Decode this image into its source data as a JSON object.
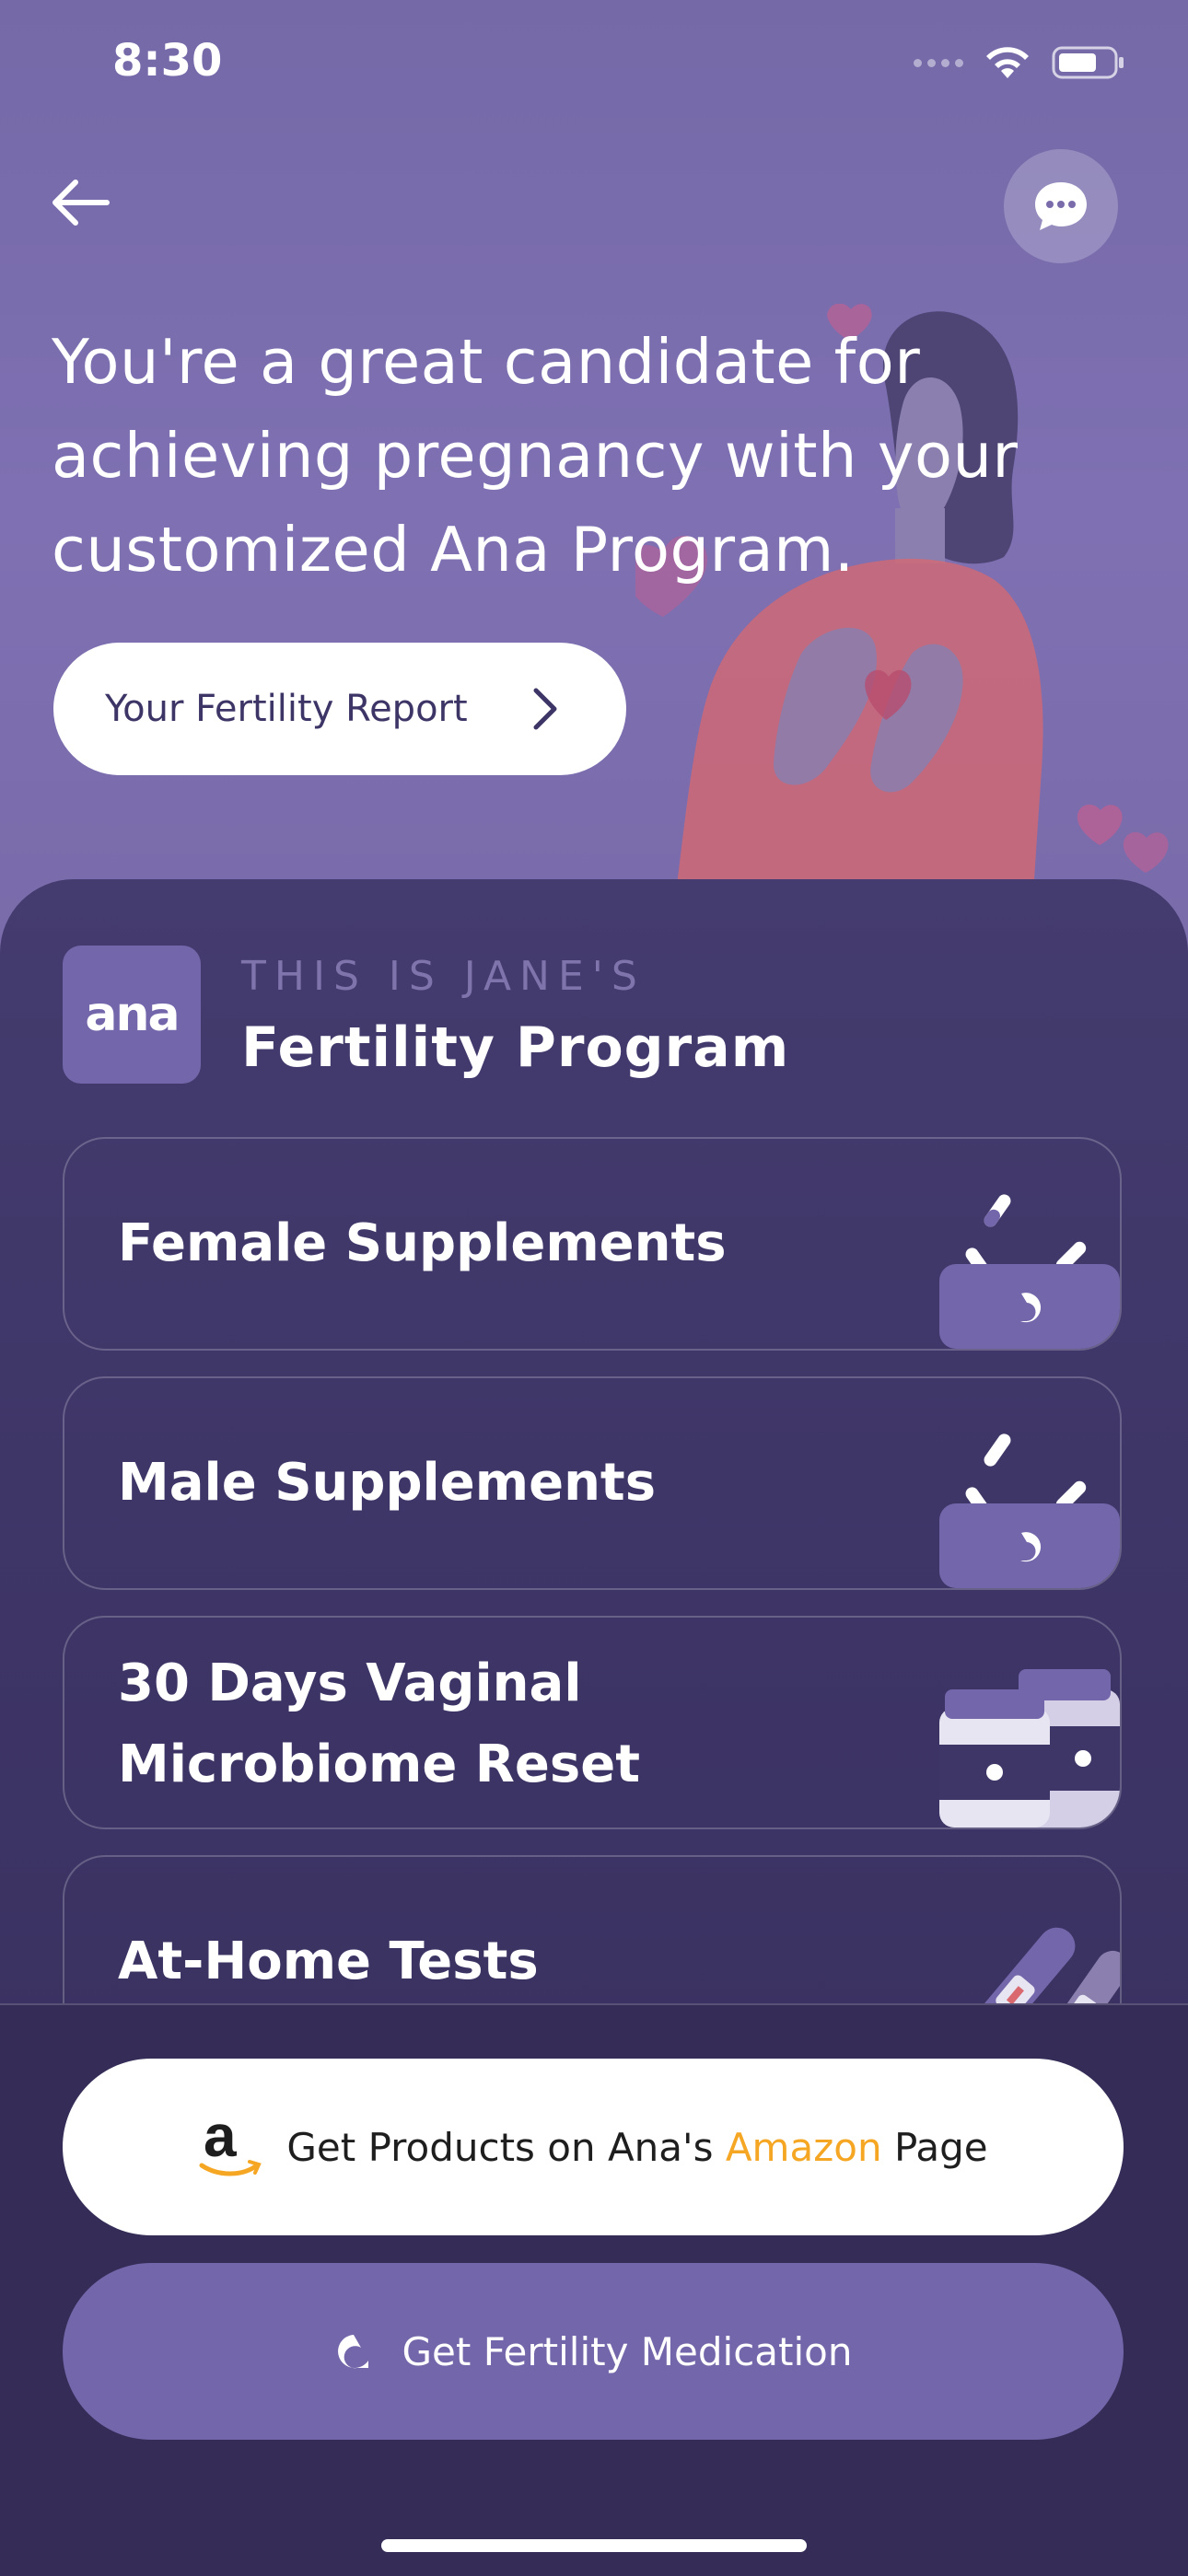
{
  "status_bar": {
    "time": "8:30"
  },
  "hero": {
    "title": "You're a great candidate for achieving pregnancy with your customized Ana Program.",
    "report_button_label": "Your Fertility Report"
  },
  "program": {
    "logo_text": "ana",
    "subtitle": "THIS IS JANE'S",
    "title": "Fertility Program",
    "cards": [
      {
        "label": "Female Supplements",
        "icon": "supplements-box-icon"
      },
      {
        "label": "Male Supplements",
        "icon": "supplements-box-icon"
      },
      {
        "label": "30 Days Vaginal Microbiome Reset",
        "line1": "30 Days Vaginal",
        "line2": "Microbiome Reset",
        "icon": "bottles-icon"
      },
      {
        "label": "At-Home Tests",
        "icon": "test-sticks-icon"
      }
    ]
  },
  "actions": {
    "amazon": {
      "prefix": "Get Products on Ana's",
      "brand": "Amazon",
      "suffix": "Page",
      "brand_color": "#f5a623"
    },
    "medication": {
      "label": "Get Fertility Medication"
    }
  },
  "colors": {
    "hero_bg": "#7a6cab",
    "sheet_bg": "#3f3668",
    "accent": "#7466aa"
  }
}
